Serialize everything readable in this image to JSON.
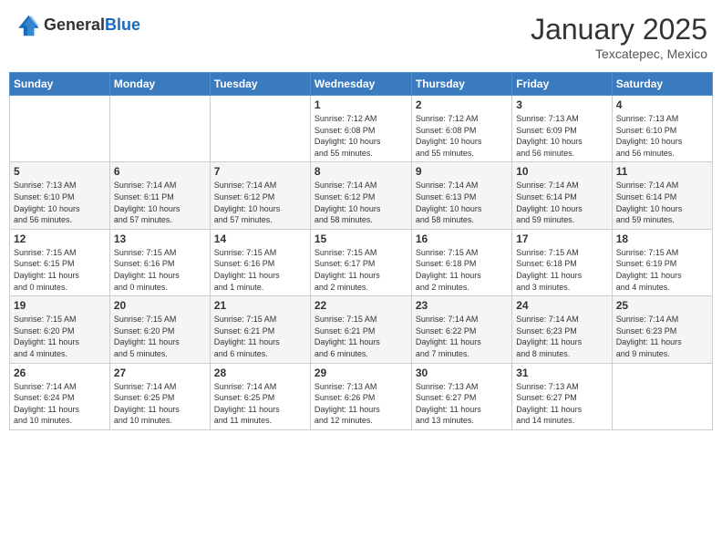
{
  "logo": {
    "general": "General",
    "blue": "Blue"
  },
  "header": {
    "month": "January 2025",
    "location": "Texcatepec, Mexico"
  },
  "weekdays": [
    "Sunday",
    "Monday",
    "Tuesday",
    "Wednesday",
    "Thursday",
    "Friday",
    "Saturday"
  ],
  "weeks": [
    [
      {
        "day": "",
        "info": ""
      },
      {
        "day": "",
        "info": ""
      },
      {
        "day": "",
        "info": ""
      },
      {
        "day": "1",
        "info": "Sunrise: 7:12 AM\nSunset: 6:08 PM\nDaylight: 10 hours\nand 55 minutes."
      },
      {
        "day": "2",
        "info": "Sunrise: 7:12 AM\nSunset: 6:08 PM\nDaylight: 10 hours\nand 55 minutes."
      },
      {
        "day": "3",
        "info": "Sunrise: 7:13 AM\nSunset: 6:09 PM\nDaylight: 10 hours\nand 56 minutes."
      },
      {
        "day": "4",
        "info": "Sunrise: 7:13 AM\nSunset: 6:10 PM\nDaylight: 10 hours\nand 56 minutes."
      }
    ],
    [
      {
        "day": "5",
        "info": "Sunrise: 7:13 AM\nSunset: 6:10 PM\nDaylight: 10 hours\nand 56 minutes."
      },
      {
        "day": "6",
        "info": "Sunrise: 7:14 AM\nSunset: 6:11 PM\nDaylight: 10 hours\nand 57 minutes."
      },
      {
        "day": "7",
        "info": "Sunrise: 7:14 AM\nSunset: 6:12 PM\nDaylight: 10 hours\nand 57 minutes."
      },
      {
        "day": "8",
        "info": "Sunrise: 7:14 AM\nSunset: 6:12 PM\nDaylight: 10 hours\nand 58 minutes."
      },
      {
        "day": "9",
        "info": "Sunrise: 7:14 AM\nSunset: 6:13 PM\nDaylight: 10 hours\nand 58 minutes."
      },
      {
        "day": "10",
        "info": "Sunrise: 7:14 AM\nSunset: 6:14 PM\nDaylight: 10 hours\nand 59 minutes."
      },
      {
        "day": "11",
        "info": "Sunrise: 7:14 AM\nSunset: 6:14 PM\nDaylight: 10 hours\nand 59 minutes."
      }
    ],
    [
      {
        "day": "12",
        "info": "Sunrise: 7:15 AM\nSunset: 6:15 PM\nDaylight: 11 hours\nand 0 minutes."
      },
      {
        "day": "13",
        "info": "Sunrise: 7:15 AM\nSunset: 6:16 PM\nDaylight: 11 hours\nand 0 minutes."
      },
      {
        "day": "14",
        "info": "Sunrise: 7:15 AM\nSunset: 6:16 PM\nDaylight: 11 hours\nand 1 minute."
      },
      {
        "day": "15",
        "info": "Sunrise: 7:15 AM\nSunset: 6:17 PM\nDaylight: 11 hours\nand 2 minutes."
      },
      {
        "day": "16",
        "info": "Sunrise: 7:15 AM\nSunset: 6:18 PM\nDaylight: 11 hours\nand 2 minutes."
      },
      {
        "day": "17",
        "info": "Sunrise: 7:15 AM\nSunset: 6:18 PM\nDaylight: 11 hours\nand 3 minutes."
      },
      {
        "day": "18",
        "info": "Sunrise: 7:15 AM\nSunset: 6:19 PM\nDaylight: 11 hours\nand 4 minutes."
      }
    ],
    [
      {
        "day": "19",
        "info": "Sunrise: 7:15 AM\nSunset: 6:20 PM\nDaylight: 11 hours\nand 4 minutes."
      },
      {
        "day": "20",
        "info": "Sunrise: 7:15 AM\nSunset: 6:20 PM\nDaylight: 11 hours\nand 5 minutes."
      },
      {
        "day": "21",
        "info": "Sunrise: 7:15 AM\nSunset: 6:21 PM\nDaylight: 11 hours\nand 6 minutes."
      },
      {
        "day": "22",
        "info": "Sunrise: 7:15 AM\nSunset: 6:21 PM\nDaylight: 11 hours\nand 6 minutes."
      },
      {
        "day": "23",
        "info": "Sunrise: 7:14 AM\nSunset: 6:22 PM\nDaylight: 11 hours\nand 7 minutes."
      },
      {
        "day": "24",
        "info": "Sunrise: 7:14 AM\nSunset: 6:23 PM\nDaylight: 11 hours\nand 8 minutes."
      },
      {
        "day": "25",
        "info": "Sunrise: 7:14 AM\nSunset: 6:23 PM\nDaylight: 11 hours\nand 9 minutes."
      }
    ],
    [
      {
        "day": "26",
        "info": "Sunrise: 7:14 AM\nSunset: 6:24 PM\nDaylight: 11 hours\nand 10 minutes."
      },
      {
        "day": "27",
        "info": "Sunrise: 7:14 AM\nSunset: 6:25 PM\nDaylight: 11 hours\nand 10 minutes."
      },
      {
        "day": "28",
        "info": "Sunrise: 7:14 AM\nSunset: 6:25 PM\nDaylight: 11 hours\nand 11 minutes."
      },
      {
        "day": "29",
        "info": "Sunrise: 7:13 AM\nSunset: 6:26 PM\nDaylight: 11 hours\nand 12 minutes."
      },
      {
        "day": "30",
        "info": "Sunrise: 7:13 AM\nSunset: 6:27 PM\nDaylight: 11 hours\nand 13 minutes."
      },
      {
        "day": "31",
        "info": "Sunrise: 7:13 AM\nSunset: 6:27 PM\nDaylight: 11 hours\nand 14 minutes."
      },
      {
        "day": "",
        "info": ""
      }
    ]
  ]
}
